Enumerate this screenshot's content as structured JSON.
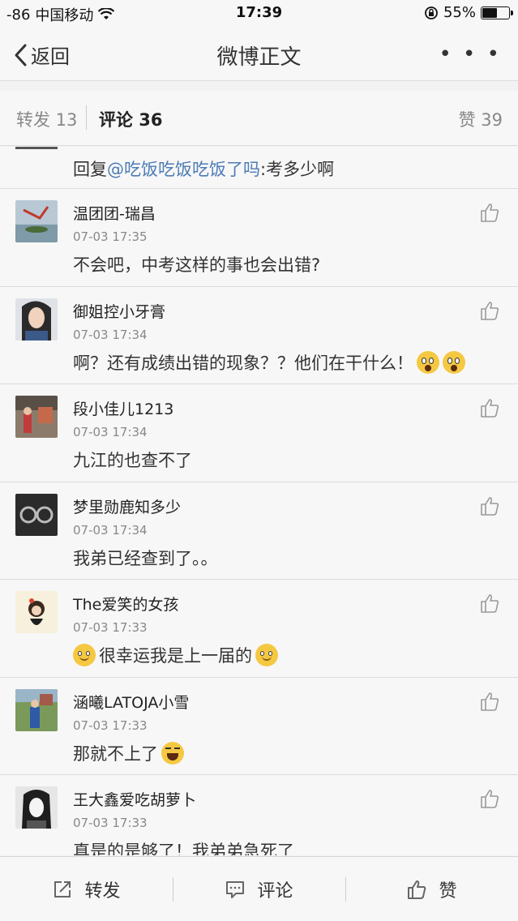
{
  "status_bar": {
    "signal": "-86",
    "carrier": "中国移动",
    "time": "17:39",
    "battery_percent": "55%",
    "battery_level": 0.55
  },
  "nav": {
    "back_label": "返回",
    "title": "微博正文",
    "more_label": "• • •"
  },
  "tabs": {
    "repost_label": "转发 13",
    "comment_label": "评论 36",
    "like_label": "赞 39"
  },
  "reply": {
    "prefix": "回复",
    "mention": "@吃饭吃饭吃饭了吗",
    "suffix": ":考多少啊"
  },
  "comments": [
    {
      "name": "温团团-瑞昌",
      "time": "07-03 17:35",
      "text": "不会吧，中考这样的事也会出错?"
    },
    {
      "name": "御姐控小牙膏",
      "time": "07-03 17:34",
      "text": "啊？还有成绩出错的现象？？他们在干什么！"
    },
    {
      "name": "段小佳儿1213",
      "time": "07-03 17:34",
      "text": "九江的也查不了"
    },
    {
      "name": "梦里勋鹿知多少",
      "time": "07-03 17:34",
      "text": "我弟已经查到了。。"
    },
    {
      "name": "The爱笑的女孩",
      "time": "07-03 17:33",
      "text": "很幸运我是上一届的"
    },
    {
      "name": "涵曦LATOJA小雪",
      "time": "07-03 17:33",
      "text": "那就不上了"
    },
    {
      "name": "王大鑫爱吃胡萝卜",
      "time": "07-03 17:33",
      "text": "真是的是够了！我弟弟急死了"
    }
  ],
  "toolbar": {
    "repost_label": "转发",
    "comment_label": "评论",
    "like_label": "赞"
  },
  "icons": {
    "back": "chevron-left-icon",
    "more": "more-dots-icon",
    "like": "thumbs-up-icon",
    "repost": "share-icon",
    "comment": "comment-icon"
  },
  "colors": {
    "mention": "#4c7bb5",
    "background": "#f7f7f7",
    "divider": "#dcdcdc"
  }
}
